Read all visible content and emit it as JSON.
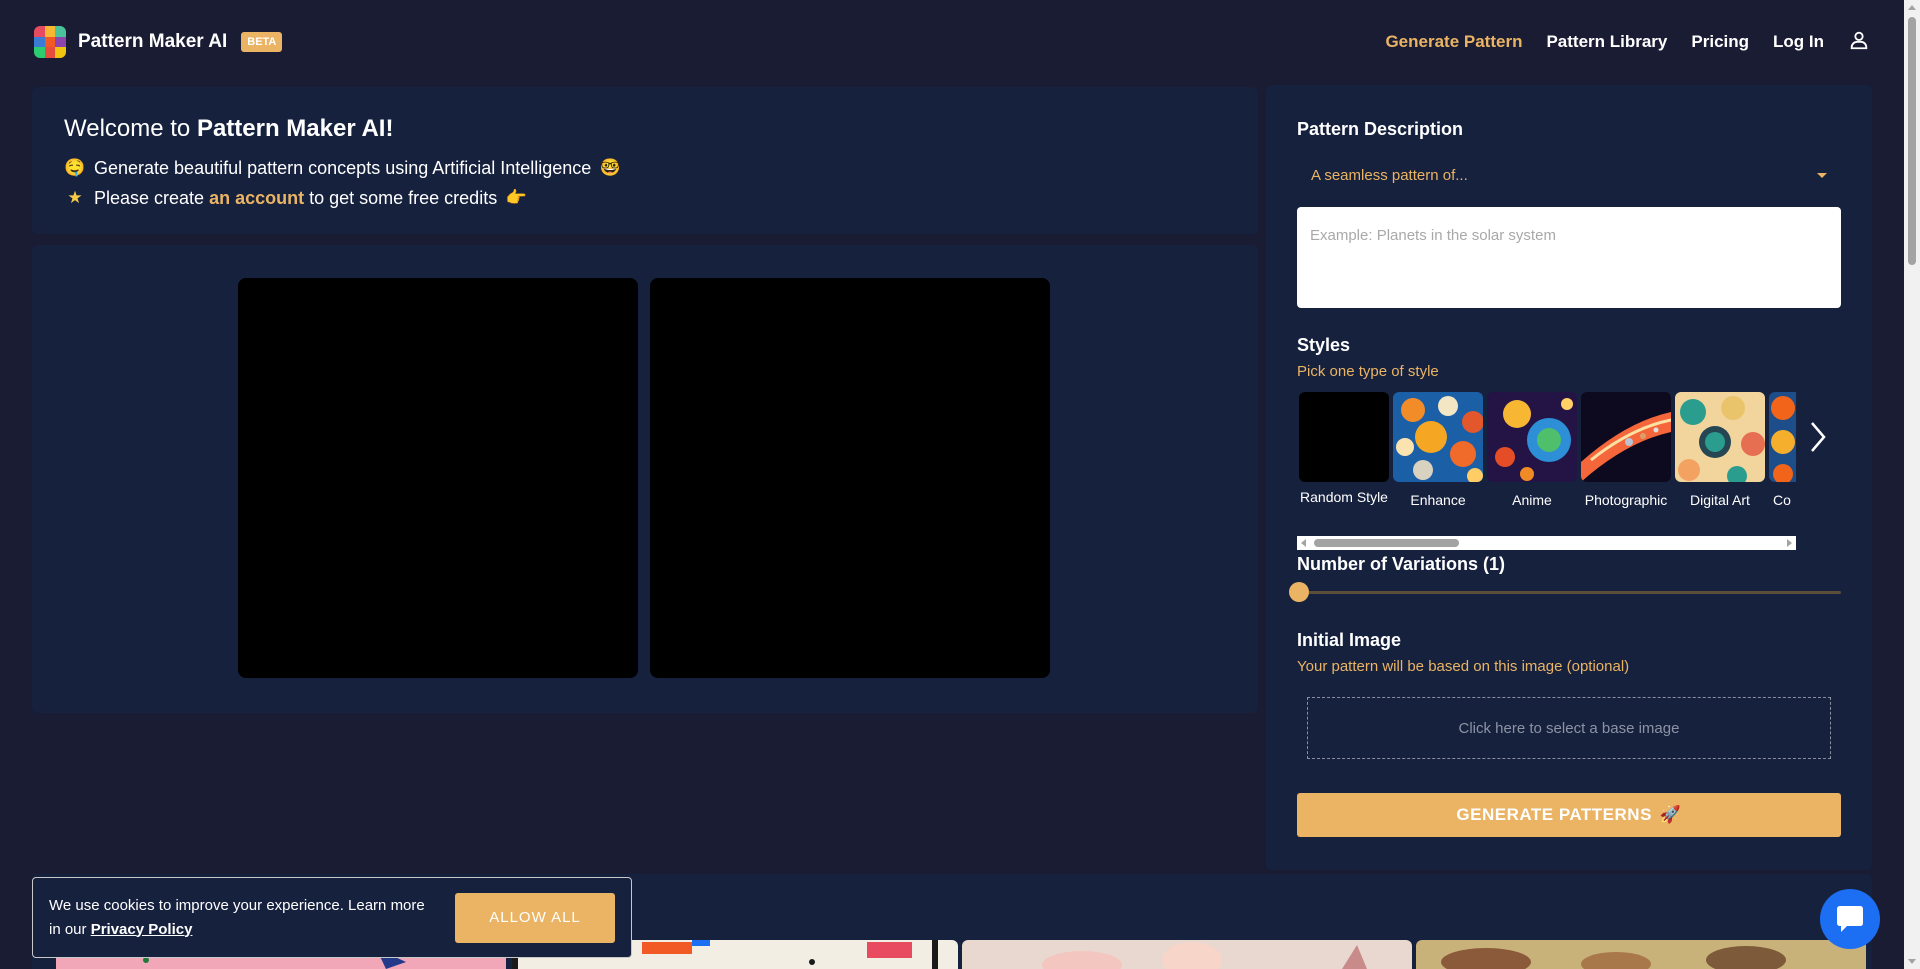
{
  "header": {
    "brand": "Pattern Maker AI",
    "badge": "BETA",
    "nav": {
      "generate": "Generate Pattern",
      "library": "Pattern Library",
      "pricing": "Pricing",
      "login": "Log In"
    },
    "icons": {
      "user": "user-icon",
      "logo": "logo-icon"
    }
  },
  "welcome": {
    "title_prefix": "Welcome to ",
    "title_brand": "Pattern Maker AI!",
    "line1_emoji": "🤤",
    "line1": "Generate beautiful pattern concepts using Artificial Intelligence",
    "line1_end_emoji": "🤓",
    "line2_emoji": "★",
    "line2_prefix": "Please create ",
    "line2_link": "an account",
    "line2_suffix": " to get some free credits",
    "line2_end_emoji": "👉"
  },
  "panel": {
    "description_label": "Pattern Description",
    "description_select": "A seamless pattern of...",
    "description_placeholder": "Example: Planets in the solar system",
    "styles_label": "Styles",
    "styles_sublabel": "Pick one type of style",
    "styles": [
      {
        "name": "Random Style"
      },
      {
        "name": "Enhance"
      },
      {
        "name": "Anime"
      },
      {
        "name": "Photographic"
      },
      {
        "name": "Digital Art"
      },
      {
        "name": "Co"
      }
    ],
    "variations_label": "Number of Variations (1)",
    "variations_value": 1,
    "initial_image_label": "Initial Image",
    "initial_image_sublabel": "Your pattern will be based on this image (optional)",
    "dropzone_text": "Click here to select a base image",
    "generate_button": "GENERATE PATTERNS",
    "generate_emoji": "🚀"
  },
  "cookie": {
    "text": "We use cookies to improve your experience. Learn more in our ",
    "link": "Privacy Policy",
    "button": "ALLOW ALL"
  },
  "colors": {
    "background": "#1a1c33",
    "card": "#16213e",
    "accent": "#eab464",
    "chat": "#1c6ef3"
  }
}
